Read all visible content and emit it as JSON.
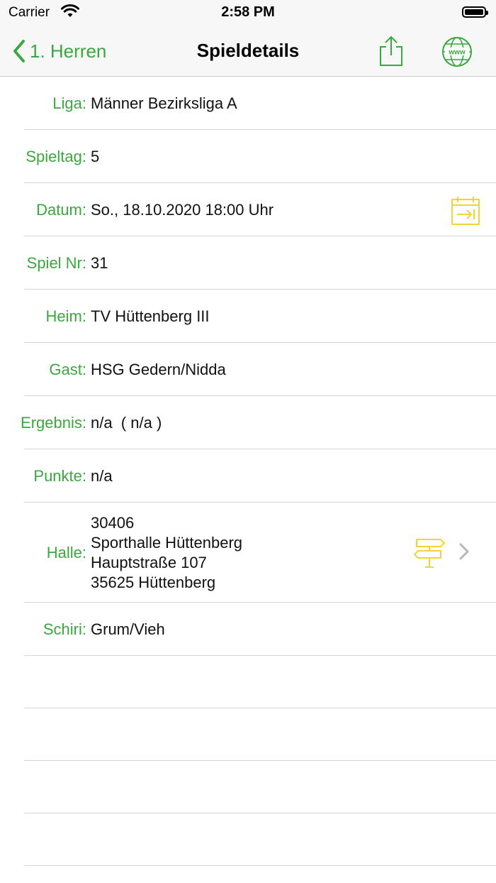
{
  "status_bar": {
    "carrier": "Carrier",
    "time": "2:58 PM"
  },
  "nav": {
    "back_label": "1. Herren",
    "title": "Spieldetails"
  },
  "colors": {
    "accent": "#3aa83f",
    "icon_yellow": "#f2d43a"
  },
  "rows": {
    "liga": {
      "label": "Liga:",
      "value": "Männer Bezirksliga A"
    },
    "spieltag": {
      "label": "Spieltag:",
      "value": "5"
    },
    "datum": {
      "label": "Datum:",
      "value": "So., 18.10.2020 18:00 Uhr"
    },
    "spielnr": {
      "label": "Spiel Nr:",
      "value": "31"
    },
    "heim": {
      "label": "Heim:",
      "value": "TV Hüttenberg III"
    },
    "gast": {
      "label": "Gast:",
      "value": "HSG Gedern/Nidda"
    },
    "ergebnis": {
      "label": "Ergebnis:",
      "value": "n/a  ( n/a )"
    },
    "punkte": {
      "label": "Punkte:",
      "value": "n/a"
    },
    "halle": {
      "label": "Halle:",
      "lines": [
        "30406",
        "Sporthalle Hüttenberg",
        "Hauptstraße 107",
        "35625 Hüttenberg"
      ]
    },
    "schiri": {
      "label": "Schiri:",
      "value": "Grum/Vieh"
    }
  },
  "icons": {
    "back": "chevron-left-icon",
    "share": "share-icon",
    "web": "globe-www-icon",
    "calendar": "calendar-add-icon",
    "directions": "signpost-icon",
    "disclosure": "chevron-right-icon"
  }
}
